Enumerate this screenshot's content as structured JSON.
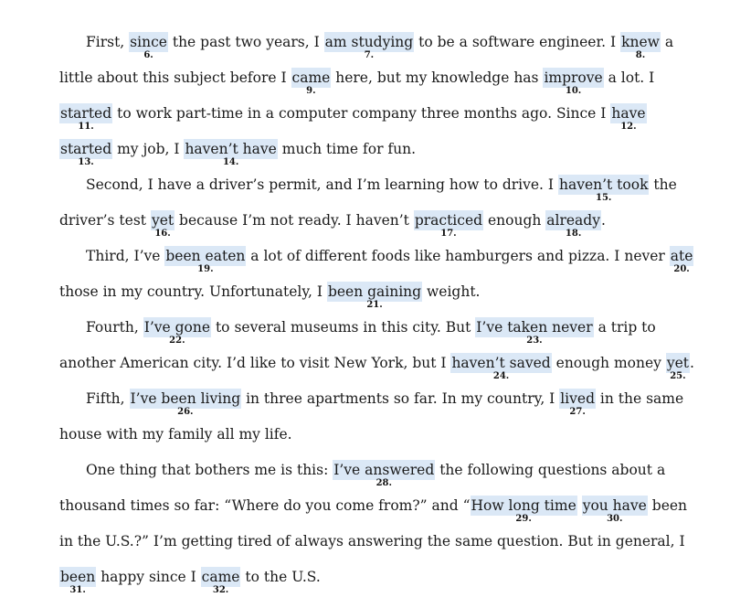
{
  "paragraphs": [
    {
      "indent": true,
      "segments": [
        {
          "text": "First, "
        },
        {
          "hl": "since",
          "n": "6."
        },
        {
          "text": " the past two years, I "
        },
        {
          "hl": "am studying",
          "n": "7."
        },
        {
          "text": " to be a software engineer. I "
        },
        {
          "hl": "knew",
          "n": "8."
        },
        {
          "text": " a little about this subject before I "
        },
        {
          "hl": "came",
          "n": "9."
        },
        {
          "text": " here, but my knowledge has "
        },
        {
          "hl": "improve",
          "n": "10."
        },
        {
          "text": " a lot. I "
        },
        {
          "hl": "started",
          "n": "11."
        },
        {
          "text": " to work part-time in a computer company three months ago. Since I "
        },
        {
          "hl": "have",
          "n": "12."
        },
        {
          "text": " "
        },
        {
          "hl": "started",
          "n": "13."
        },
        {
          "text": " my job, I "
        },
        {
          "hl": "haven’t have",
          "n": "14."
        },
        {
          "text": " much time for fun."
        }
      ]
    },
    {
      "indent": true,
      "segments": [
        {
          "text": "Second, I have a driver’s permit, and I’m learning how to drive. I "
        },
        {
          "hl": "haven’t took",
          "n": "15."
        },
        {
          "text": " the driver’s test "
        },
        {
          "hl": "yet",
          "n": "16."
        },
        {
          "text": " because I’m not ready. I haven’t "
        },
        {
          "hl": "practiced",
          "n": "17."
        },
        {
          "text": " enough "
        },
        {
          "hl": "already",
          "n": "18."
        },
        {
          "text": "."
        }
      ]
    },
    {
      "indent": true,
      "segments": [
        {
          "text": "Third, I’ve "
        },
        {
          "hl": "been eaten",
          "n": "19."
        },
        {
          "text": " a lot of different foods like hamburgers and pizza. I never "
        },
        {
          "hl": "ate",
          "n": "20."
        },
        {
          "text": " those in my country. Unfortunately, I "
        },
        {
          "hl": "been gaining",
          "n": "21."
        },
        {
          "text": " weight."
        }
      ]
    },
    {
      "indent": true,
      "segments": [
        {
          "text": "Fourth, "
        },
        {
          "hl": "I’ve gone",
          "n": "22."
        },
        {
          "text": " to several museums in this city. But "
        },
        {
          "hl": "I’ve taken never",
          "n": "23."
        },
        {
          "text": " a trip to another American city. I’d like to visit New York, but I "
        },
        {
          "hl": "haven’t saved",
          "n": "24."
        },
        {
          "text": " enough money "
        },
        {
          "hl": "yet",
          "n": "25."
        },
        {
          "text": "."
        }
      ]
    },
    {
      "indent": true,
      "segments": [
        {
          "text": "Fifth, "
        },
        {
          "hl": "I’ve been living",
          "n": "26."
        },
        {
          "text": " in three apartments so far. In my country, I "
        },
        {
          "hl": "lived",
          "n": "27."
        },
        {
          "text": " in the same house with my family all my life."
        }
      ]
    },
    {
      "indent": true,
      "segments": [
        {
          "text": "One thing that bothers me is this: "
        },
        {
          "hl": "I’ve answered",
          "n": "28."
        },
        {
          "text": " the following questions about a thousand times so far: “Where do you come from?” and “"
        },
        {
          "hl": "How long time",
          "n": "29."
        },
        {
          "text": " "
        },
        {
          "hl": "you have",
          "n": "30."
        },
        {
          "text": " been in the U.S.?” I’m getting tired of always answering the same question. But in general, I "
        },
        {
          "hl": "been",
          "n": "31."
        },
        {
          "text": " happy since I "
        },
        {
          "hl": "came",
          "n": "32."
        },
        {
          "text": " to the U.S."
        }
      ]
    }
  ]
}
